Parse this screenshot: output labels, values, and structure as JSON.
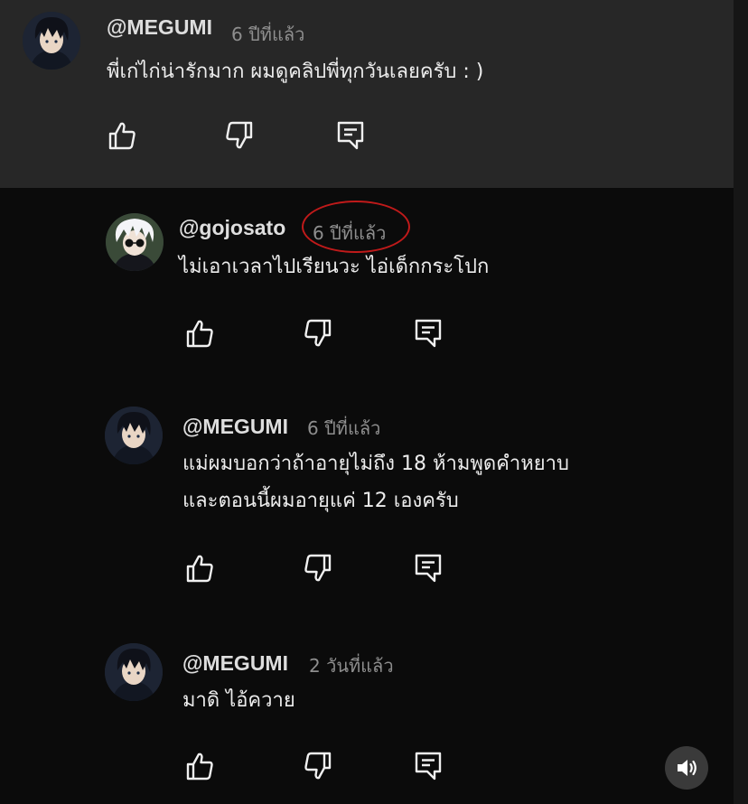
{
  "comments": [
    {
      "handle": "@MEGUMI",
      "time": "6 ปีที่แล้ว",
      "lines": [
        "พี่เก่ไก่น่ารักมาก ผมดูคลิปพี่ทุกวันเลยครับ : )"
      ]
    },
    {
      "handle": "@gojosato",
      "time": "6 ปีที่แล้ว",
      "lines": [
        "ไม่เอาเวลาไปเรียนวะ ไอ่เด็กกระโปก"
      ]
    },
    {
      "handle": "@MEGUMI",
      "time": "6 ปีที่แล้ว",
      "lines": [
        "แม่ผมบอกว่าถ้าอายุไม่ถึง 18 ห้ามพูดคำหยาบ",
        "และตอนนี้ผมอายุแค่ 12 เองครับ"
      ]
    },
    {
      "handle": "@MEGUMI",
      "time": "2 วันที่แล้ว",
      "lines": [
        "มาดิ ไอ้ควาย"
      ]
    }
  ],
  "icons": {
    "like": "thumbs-up-icon",
    "dislike": "thumbs-down-icon",
    "reply": "reply-icon",
    "volume": "volume-icon"
  },
  "colors": {
    "highlighted_comment_bg": "#272727",
    "background": "#0b0b0b",
    "annotation_circle": "#c01a1a"
  }
}
